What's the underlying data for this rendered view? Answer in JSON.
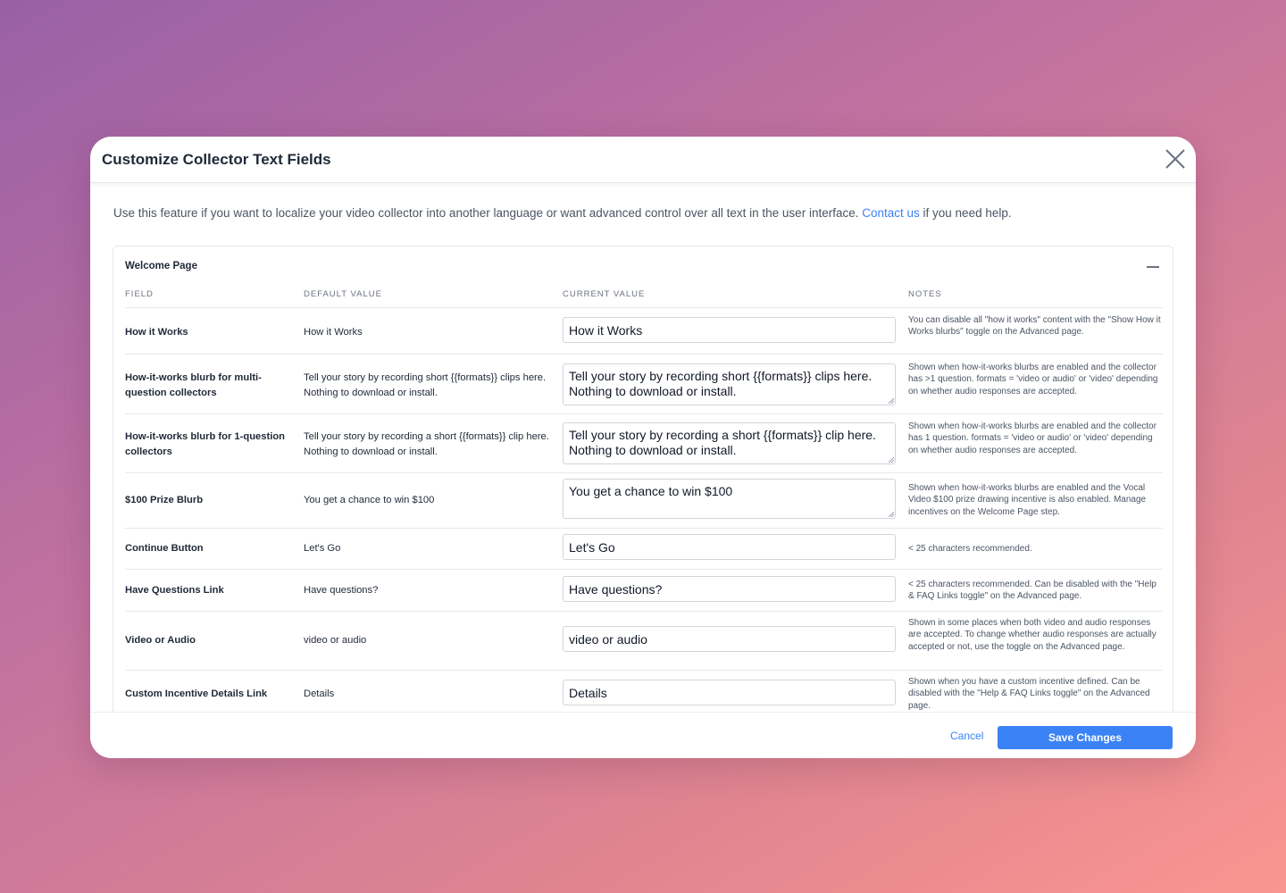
{
  "modal": {
    "title": "Customize Collector Text Fields"
  },
  "intro": {
    "text_before": "Use this feature if you want to localize your video collector into another language or want advanced control over all text in the user interface. ",
    "link": "Contact us",
    "text_after": " if you need help."
  },
  "section": {
    "title": "Welcome Page",
    "columns": [
      "FIELD",
      "DEFAULT VALUE",
      "CURRENT VALUE",
      "NOTES"
    ]
  },
  "rows": [
    {
      "field": "How it Works",
      "default": "How it Works",
      "current": "How it Works",
      "notes": "You can disable all \"how it works\" content with the \"Show How it Works blurbs\" toggle on the Advanced page."
    },
    {
      "field": "How-it-works blurb for multi-question collectors",
      "default": "Tell your story by recording short {{formats}} clips here. Nothing to download or install.",
      "current": "Tell your story by recording short {{formats}} clips here. Nothing to download or install.",
      "notes": "Shown when how-it-works blurbs are enabled and the collector has >1 question. formats = 'video or audio' or 'video' depending on whether audio responses are accepted."
    },
    {
      "field": "How-it-works blurb for 1-question collectors",
      "default": "Tell your story by recording a short {{formats}} clip here. Nothing to download or install.",
      "current": "Tell your story by recording a short {{formats}} clip here. Nothing to download or install.",
      "notes": "Shown when how-it-works blurbs are enabled and the collector has 1 question. formats = 'video or audio' or 'video' depending on whether audio responses are accepted."
    },
    {
      "field": "$100 Prize Blurb",
      "default": "You get a chance to win $100",
      "current": "You get a chance to win $100",
      "notes": "Shown when how-it-works blurbs are enabled and the Vocal Video $100 prize drawing incentive is also enabled. Manage incentives on the Welcome Page step."
    },
    {
      "field": "Continue Button",
      "default": "Let's Go",
      "current": "Let's Go",
      "notes": "< 25 characters recommended."
    },
    {
      "field": "Have Questions Link",
      "default": "Have questions?",
      "current": "Have questions?",
      "notes": "< 25 characters recommended. Can be disabled with the \"Help & FAQ Links toggle\" on the Advanced page."
    },
    {
      "field": "Video or Audio",
      "default": "video or audio",
      "current": "video or audio",
      "notes": "Shown in some places when both video and audio responses are accepted. To change whether audio responses are actually accepted or not, use the toggle on the Advanced page."
    },
    {
      "field": "Custom Incentive Details Link",
      "default": "Details",
      "current": "Details",
      "notes": "Shown when you have a custom incentive defined. Can be disabled with the \"Help & FAQ Links toggle\" on the Advanced page."
    }
  ],
  "footer": {
    "cancel_label": "Cancel",
    "save_label": "Save Changes"
  }
}
